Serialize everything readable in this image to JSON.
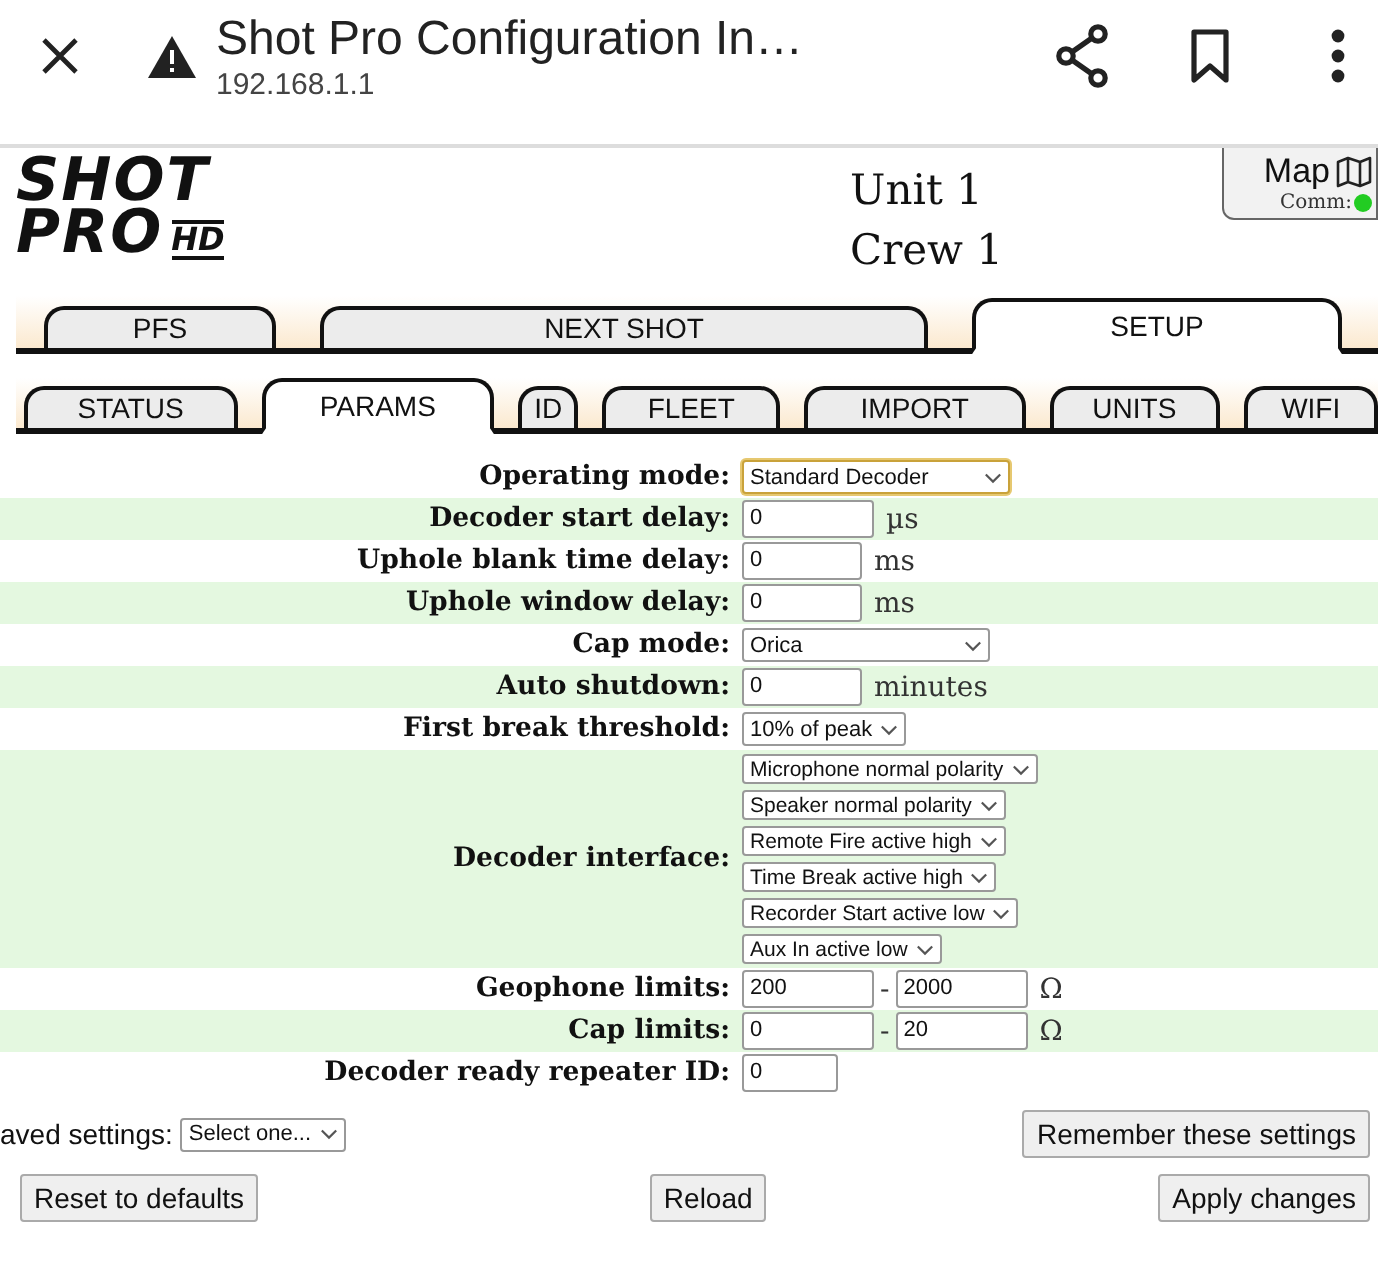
{
  "browser": {
    "title": "Shot Pro Configuration In…",
    "url": "192.168.1.1"
  },
  "header": {
    "logo_line_1": "SHOT",
    "logo_line_2": "PRO",
    "logo_badge": "HD",
    "unit": "Unit 1",
    "crew": "Crew 1",
    "map_button": "Map",
    "comm_label": "Comm:",
    "comm_connected": true
  },
  "main_tabs": [
    {
      "label": "PFS",
      "selected": false
    },
    {
      "label": "NEXT SHOT",
      "selected": false
    },
    {
      "label": "SETUP",
      "selected": true
    }
  ],
  "sub_tabs": [
    {
      "label": "STATUS",
      "selected": false
    },
    {
      "label": "PARAMS",
      "selected": true
    },
    {
      "label": "ID",
      "selected": false
    },
    {
      "label": "FLEET",
      "selected": false
    },
    {
      "label": "IMPORT",
      "selected": false
    },
    {
      "label": "UNITS",
      "selected": false
    },
    {
      "label": "WIFI",
      "selected": false
    }
  ],
  "params": [
    {
      "kind": "select",
      "label": "Operating mode:",
      "value": "Standard Decoder",
      "focused": true
    },
    {
      "kind": "input",
      "label": "Decoder start delay:",
      "value": "0",
      "unit": "µs"
    },
    {
      "kind": "input",
      "label": "Uphole blank time delay:",
      "value": "0",
      "unit": "ms"
    },
    {
      "kind": "input",
      "label": "Uphole window delay:",
      "value": "0",
      "unit": "ms"
    },
    {
      "kind": "select",
      "label": "Cap mode:",
      "value": "Orica",
      "focused": false
    },
    {
      "kind": "input",
      "label": "Auto shutdown:",
      "value": "0",
      "unit": "minutes"
    },
    {
      "kind": "select-small",
      "label": "First break threshold:",
      "value": "10% of peak",
      "focused": false
    },
    {
      "kind": "selects",
      "label": "Decoder interface:",
      "values": [
        "Microphone normal polarity",
        "Speaker normal polarity",
        "Remote Fire active high",
        "Time Break active high",
        "Recorder Start active low",
        "Aux In active low"
      ]
    },
    {
      "kind": "range",
      "label": "Geophone limits:",
      "min": "200",
      "separator": "-",
      "max": "2000",
      "unit": "Ω"
    },
    {
      "kind": "range",
      "label": "Cap limits:",
      "min": "0",
      "separator": "-",
      "max": "20",
      "unit": "Ω"
    },
    {
      "kind": "input-short",
      "label": "Decoder ready repeater ID:",
      "value": "0"
    }
  ],
  "saved_settings": {
    "label": "aved settings:",
    "value": "Select one..."
  },
  "remember_button": "Remember these settings",
  "actions": [
    "Reset to defaults",
    "Reload",
    "Apply changes"
  ]
}
